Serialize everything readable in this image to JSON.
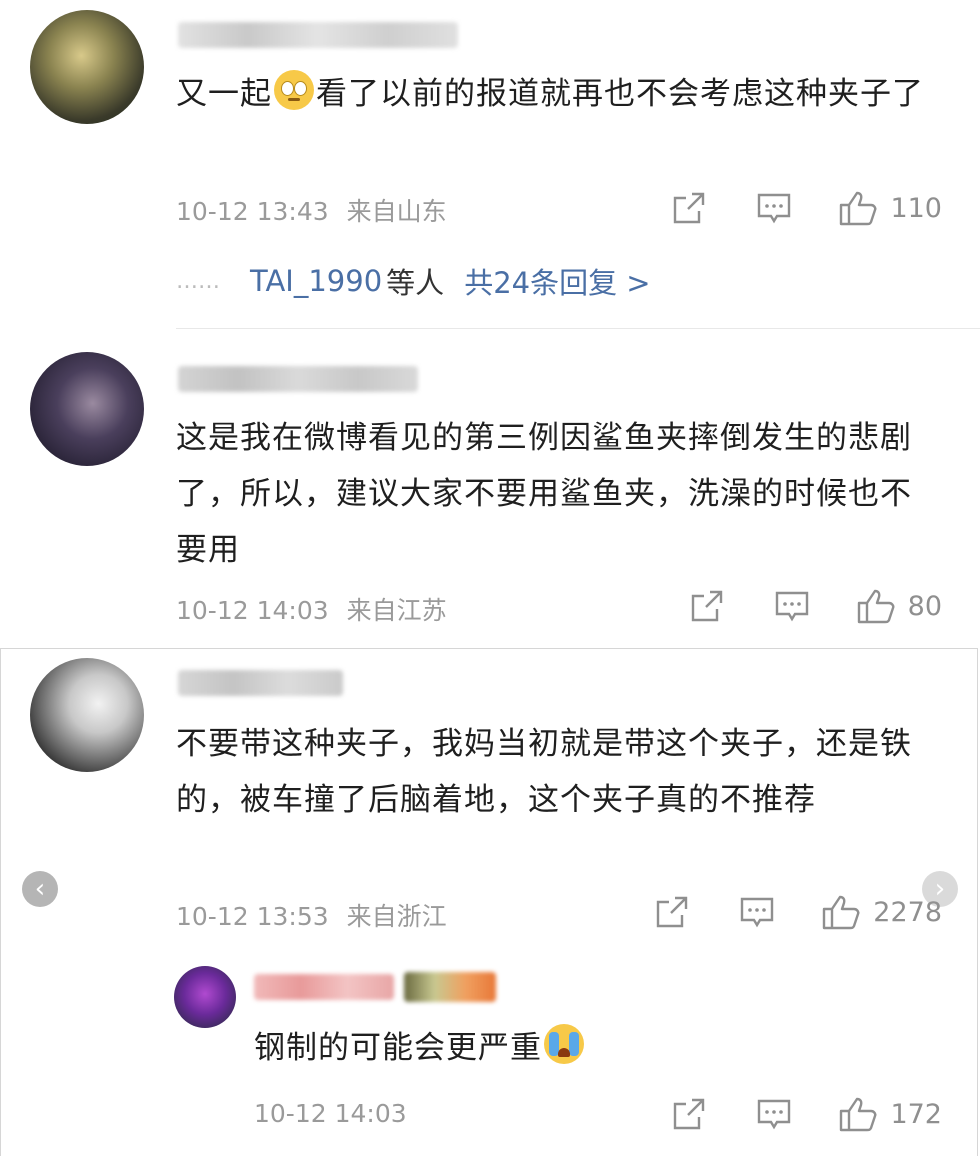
{
  "comments": [
    {
      "text_before_emoji": "又一起",
      "text_after_emoji": "看了以前的报道就再也不会考虑这种夹子了",
      "time": "10-12 13:43",
      "location": "来自山东",
      "likes": "110",
      "replies": {
        "dots": "……",
        "user": "TAI_1990",
        "etc": "等人",
        "count": "共24条回复 >"
      }
    },
    {
      "text": "这是我在微博看见的第三例因鲨鱼夹摔倒发生的悲剧了，所以，建议大家不要用鲨鱼夹，洗澡的时候也不要用",
      "time": "10-12 14:03",
      "location": "来自江苏",
      "likes": "80"
    },
    {
      "text": "不要带这种夹子，我妈当初就是带这个夹子，还是铁的，被车撞了后脑着地，这个夹子真的不推荐",
      "time": "10-12 13:53",
      "location": "来自浙江",
      "likes": "2278"
    }
  ],
  "reply": {
    "text": "钢制的可能会更严重",
    "time": "10-12 14:03",
    "likes": "172"
  },
  "nav": {
    "prev": "‹",
    "next": "›"
  },
  "colors": {
    "link": "#4a6fa5",
    "meta": "#9a9a9a"
  }
}
